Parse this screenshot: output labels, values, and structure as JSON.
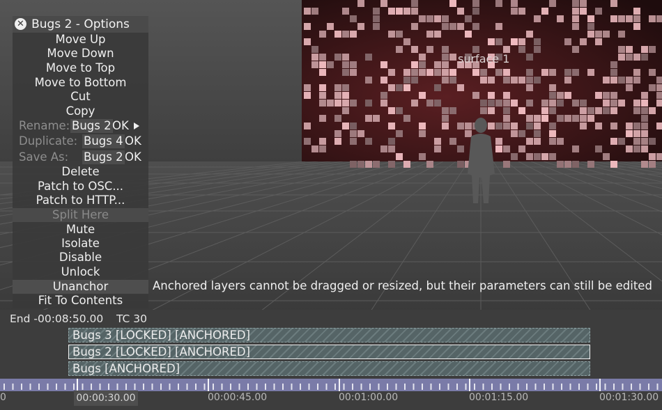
{
  "stage": {
    "surface_label": "surface 1"
  },
  "menu": {
    "title": "Bugs 2 - Options",
    "items": {
      "move_up": "Move Up",
      "move_down": "Move Down",
      "move_top": "Move to Top",
      "move_bottom": "Move to Bottom",
      "cut": "Cut",
      "copy": "Copy",
      "delete": "Delete",
      "patch_osc": "Patch to OSC...",
      "patch_http": "Patch to HTTP...",
      "split_here": "Split Here",
      "mute": "Mute",
      "isolate": "Isolate",
      "disable": "Disable",
      "unlock": "Unlock",
      "unanchor": "Unanchor",
      "fit_contents": "Fit To Contents"
    },
    "rename": {
      "label": "Rename:",
      "value": "Bugs 2",
      "ok": "OK"
    },
    "duplicate": {
      "label": "Duplicate:",
      "value": "Bugs 4",
      "ok": "OK"
    },
    "save_as": {
      "label": "Save As:",
      "value": "Bugs 2",
      "ok": "OK"
    },
    "tooltip": "Anchored layers cannot be dragged or resized, but their parameters can still be edited"
  },
  "timeline": {
    "end": "End -00:08:50.00",
    "tc": "TC 30",
    "layers": [
      "Bugs 3 [LOCKED] [ANCHORED]",
      "Bugs 2 [LOCKED] [ANCHORED]",
      "Bugs [ANCHORED]"
    ],
    "ruler": {
      "start": "0",
      "playhead": "00:00:30.00",
      "ticks": [
        "00:00:45.00",
        "00:01:00.00",
        "00:01:15.00",
        "00:01:30.00"
      ]
    }
  },
  "colors": {
    "ruler": "#7a7ba8",
    "layer": "#556466",
    "menu": "#3a3a3a"
  }
}
